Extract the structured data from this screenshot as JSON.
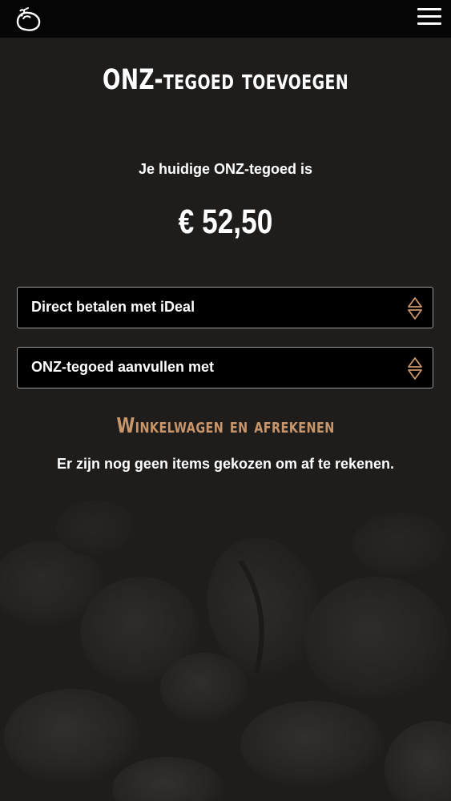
{
  "header": {
    "logo_icon": "onz-logo-icon",
    "menu_icon": "hamburger-menu-icon"
  },
  "main": {
    "title": "ONZ-tegoed toevoegen",
    "balance_label": "Je huidige ONZ-tegoed is",
    "balance_amount": "€ 52,50",
    "payment_select": {
      "selected": "Direct betalen met iDeal",
      "icon": "select-arrows-icon"
    },
    "topup_select": {
      "selected": "ONZ-tegoed aanvullen met",
      "icon": "select-arrows-icon"
    },
    "cart_title": "Winkelwagen en afrekenen",
    "cart_message": "Er zijn nog geen items gekozen om af te rekenen."
  },
  "colors": {
    "topbar": "#050505",
    "background": "#1e1d1c",
    "accent": "#c9956a",
    "select_border": "#9a9a9a",
    "select_bg": "#000000"
  }
}
